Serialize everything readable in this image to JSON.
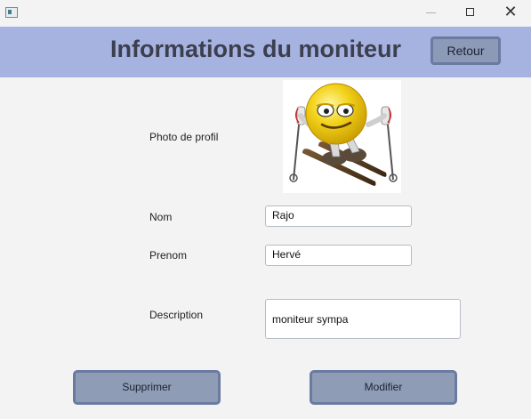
{
  "header": {
    "title": "Informations du moniteur",
    "back_label": "Retour"
  },
  "form": {
    "photo_label": "Photo de profil",
    "nom_label": "Nom",
    "nom_value": "Rajo",
    "prenom_label": "Prenom",
    "prenom_value": "Hervé",
    "description_label": "Description",
    "description_value": "moniteur sympa"
  },
  "actions": {
    "delete_label": "Supprimer",
    "edit_label": "Modifier"
  },
  "colors": {
    "header_bg": "#a6b2e0",
    "button_bg": "#8e9cb6",
    "button_border": "#6a7aa0",
    "window_bg": "#f3f3f3"
  },
  "icons": [
    "app-icon",
    "minimize-icon",
    "maximize-icon",
    "close-icon",
    "skier-smiley-avatar"
  ]
}
